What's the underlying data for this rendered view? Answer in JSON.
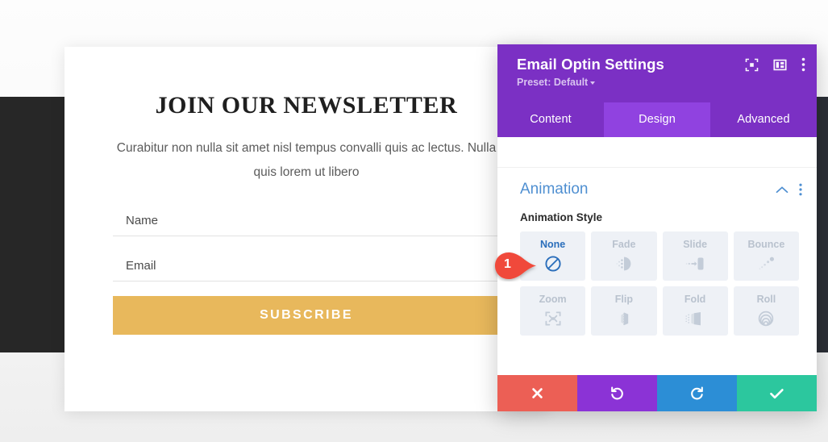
{
  "optin": {
    "title": "JOIN OUR NEWSLETTER",
    "subtitle": "Curabitur non nulla sit amet nisl tempus convalli quis ac lectus. Nulla quis lorem ut libero",
    "fields": [
      {
        "label": "Name",
        "placeholder": "Name"
      },
      {
        "label": "Email",
        "placeholder": "Email"
      }
    ],
    "submit_label": "SUBSCRIBE",
    "button_color": "#e8b85c"
  },
  "panel": {
    "title": "Email Optin Settings",
    "preset_label": "Preset: Default",
    "header_color": "#7b30c4",
    "active_tab_color": "#9042e0",
    "header_icons": [
      {
        "name": "focus-icon"
      },
      {
        "name": "layout-icon"
      },
      {
        "name": "more-options-icon"
      }
    ],
    "tabs": [
      {
        "label": "Content",
        "active": false
      },
      {
        "label": "Design",
        "active": true
      },
      {
        "label": "Advanced",
        "active": false
      }
    ],
    "section": {
      "title": "Animation",
      "title_color": "#4f8fd1",
      "collapse_icon": "chevron-up-icon",
      "menu_icon": "more-options-icon"
    },
    "option_label": "Animation Style",
    "animation_styles": [
      {
        "label": "None",
        "icon": "no-entry-icon",
        "selected": true
      },
      {
        "label": "Fade",
        "icon": "fade-icon",
        "selected": false
      },
      {
        "label": "Slide",
        "icon": "slide-icon",
        "selected": false
      },
      {
        "label": "Bounce",
        "icon": "bounce-icon",
        "selected": false
      },
      {
        "label": "Zoom",
        "icon": "zoom-icon",
        "selected": false
      },
      {
        "label": "Flip",
        "icon": "flip-icon",
        "selected": false
      },
      {
        "label": "Fold",
        "icon": "fold-icon",
        "selected": false
      },
      {
        "label": "Roll",
        "icon": "roll-icon",
        "selected": false
      }
    ],
    "footer_buttons": [
      {
        "name": "cancel",
        "icon": "close-icon",
        "color": "#ec5f55"
      },
      {
        "name": "undo",
        "icon": "undo-icon",
        "color": "#8b33d6"
      },
      {
        "name": "redo",
        "icon": "redo-icon",
        "color": "#2c8ed6"
      },
      {
        "name": "save",
        "icon": "check-icon",
        "color": "#2cc79e"
      }
    ]
  },
  "callout": {
    "number": "1",
    "color": "#f04a3a"
  }
}
